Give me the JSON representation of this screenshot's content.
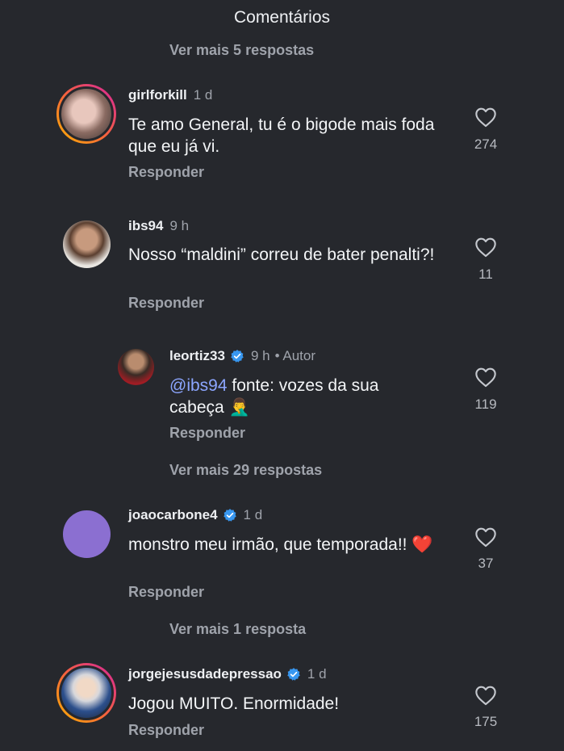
{
  "header": {
    "title": "Comentários"
  },
  "colors": {
    "background": "#26282d",
    "mention": "#8ca6ff",
    "verified": "#3897f0",
    "ring_start": "#ffb300",
    "ring_end": "#d6249f"
  },
  "top_view_more": "Ver mais 5 respostas",
  "comments": [
    {
      "username": "girlforkill",
      "time": "1 d",
      "text": "Te amo General, tu é o bigode mais foda que eu já vi.",
      "reply_label": "Responder",
      "likes": "274"
    },
    {
      "username": "ibs94",
      "time": "9 h",
      "text": "Nosso “maldini” correu de bater penalti?!",
      "reply_label": "Responder",
      "likes": "11"
    },
    {
      "username": "leortiz33",
      "time": "9 h",
      "author_label": "• Autor",
      "mention": "@ibs94",
      "text": " fonte: vozes da sua cabeça 🤦‍♂️",
      "reply_label": "Responder",
      "likes": "119",
      "view_more": "Ver mais 29 respostas"
    },
    {
      "username": "joaocarbone4",
      "time": "1 d",
      "text": "monstro meu irmão, que temporada!! ❤️",
      "reply_label": "Responder",
      "likes": "37",
      "view_more": "Ver mais 1 resposta"
    },
    {
      "username": "jorgejesusdadepressao",
      "time": "1 d",
      "text": "Jogou MUITO. Enormidade!",
      "reply_label": "Responder",
      "likes": "175"
    }
  ],
  "icons": {
    "like": "heart-outline-icon",
    "verified": "verified-badge-icon"
  }
}
